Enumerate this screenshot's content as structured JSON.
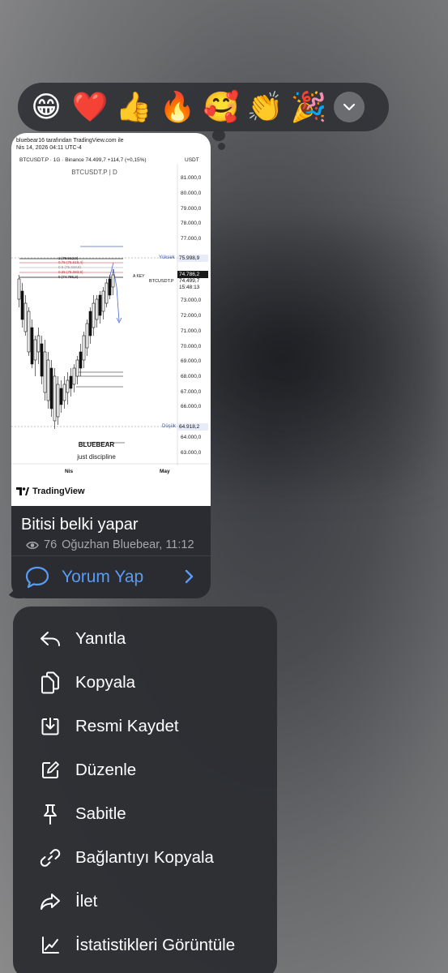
{
  "reactions": {
    "items": [
      {
        "emoji": "😁",
        "name": "grinning-face-emoji"
      },
      {
        "emoji": "❤️",
        "name": "red-heart-emoji"
      },
      {
        "emoji": "👍",
        "name": "thumbs-up-emoji"
      },
      {
        "emoji": "🔥",
        "name": "fire-emoji"
      },
      {
        "emoji": "🥰",
        "name": "smiling-face-hearts-emoji"
      },
      {
        "emoji": "👏",
        "name": "clapping-hands-emoji"
      },
      {
        "emoji": "🎉",
        "name": "party-popper-emoji"
      }
    ],
    "expand_icon": "chevron-down-icon"
  },
  "message": {
    "image": {
      "header_line1": "bluebear16 tarafından TradingView.com ile",
      "header_line2": "Nis 14, 2026 04:11 UTC-4",
      "symbol_line": "BTCUSDT.P · 1G · Binance  74.499,7  +114,7 (+0,15%)",
      "currency": "USDT",
      "chart_subtitle": "BTCUSDT.P | D",
      "brand_name": "BLUEBEAR",
      "brand_tagline": "just discipline",
      "watermark": "TradingView",
      "price_ticks": [
        "81.000,0",
        "80.000,0",
        "79.000,0",
        "78.000,0",
        "77.000,0",
        "73.000,0",
        "72.000,0",
        "71.000,0",
        "70.000,0",
        "69.000,0",
        "68.000,0",
        "67.000,0",
        "66.000,0",
        "64.000,0",
        "63.000,0"
      ],
      "high_label": "Yüksek",
      "high_value": "75.998,9",
      "current_value": "74.786,2",
      "last_value": "74.499,7",
      "countdown": "15:48:13",
      "low_label": "Düşük",
      "low_value": "64.918,2",
      "symbol_tag": "BTCUSDT.P",
      "key_tag": "A KEY",
      "fib_levels": [
        "1 (75.912,9)",
        "0.75 (75.616,4)",
        "0.5 (75.319,8)",
        "0.25 (75.083,9)",
        "0 (74.786,2)"
      ],
      "x_ticks": [
        "Nis",
        "May"
      ]
    },
    "caption": "Bitisi belki yapar",
    "views": "76",
    "author_time": "Oğuzhan Bluebear, 11:12",
    "comment_label": "Yorum Yap"
  },
  "menu": {
    "items": [
      {
        "label": "Yanıtla",
        "icon": "reply-icon"
      },
      {
        "label": "Kopyala",
        "icon": "copy-icon"
      },
      {
        "label": "Resmi Kaydet",
        "icon": "save-image-icon"
      },
      {
        "label": "Düzenle",
        "icon": "edit-icon"
      },
      {
        "label": "Sabitle",
        "icon": "pin-icon"
      },
      {
        "label": "Bağlantıyı Kopyala",
        "icon": "link-icon"
      },
      {
        "label": "İlet",
        "icon": "forward-icon"
      },
      {
        "label": "İstatistikleri Görüntüle",
        "icon": "statistics-icon"
      }
    ]
  },
  "colors": {
    "accent": "#5a9cf5",
    "menu_bg": "#2c2e32",
    "bubble_bg": "#2a2c31"
  }
}
